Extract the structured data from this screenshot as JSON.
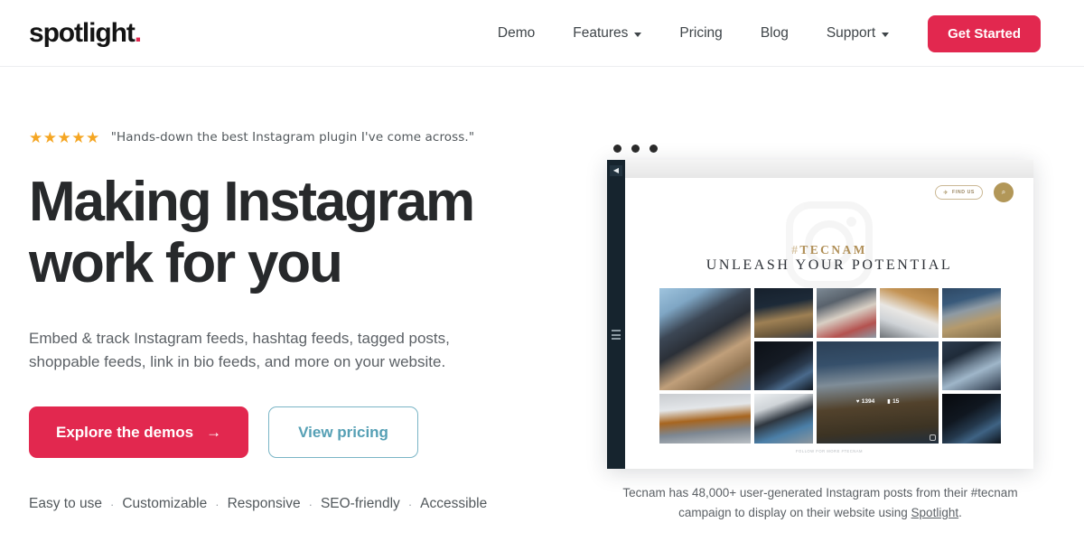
{
  "brand": {
    "name": "spotlight",
    "dot": ".",
    "accent": "#e2284f"
  },
  "nav": {
    "items": [
      {
        "label": "Demo",
        "caret": false
      },
      {
        "label": "Features",
        "caret": true
      },
      {
        "label": "Pricing",
        "caret": false
      },
      {
        "label": "Blog",
        "caret": false
      },
      {
        "label": "Support",
        "caret": true
      }
    ],
    "cta": "Get Started"
  },
  "hero": {
    "stars": "★★★★★",
    "rating_quote": "\"Hands-down the best Instagram plugin I've come across.\"",
    "headline_line1": "Making Instagram",
    "headline_line2": "work for you",
    "subhead_line1": "Embed & track Instagram feeds, hashtag feeds, tagged posts,",
    "subhead_line2": "shoppable feeds, link in bio feeds, and more on your website.",
    "primary_button": "Explore the demos",
    "primary_arrow": "→",
    "secondary_button": "View pricing",
    "features": [
      "Easy to use",
      "Customizable",
      "Responsive",
      "SEO-friendly",
      "Accessible"
    ],
    "feature_separator": "·"
  },
  "mockup": {
    "window_dots": 3,
    "rail_back_icon": "◀",
    "find_us_label": "FIND US",
    "find_us_icon": "✈",
    "search_icon": "⌕",
    "hash_mark": "#",
    "hashtag": "TECNAM",
    "slogan": "UNLEASH YOUR POTENTIAL",
    "post_likes": "1394",
    "post_comments": "15",
    "like_icon": "♥",
    "comment_icon": "▮",
    "mini_caption": "FOLLOW FOR MORE #TECNAM",
    "caption_line1": "Tecnam has 48,000+ user-generated Instagram posts from their",
    "caption_line2_pre": "#tecnam campaign to display on their website using ",
    "caption_link": "Spotlight",
    "caption_line2_post": ".",
    "tiles": [
      {
        "name": "pilot-cockpit-selfie",
        "css": "linear-gradient(150deg,#9fc4de 0%,#7fa6c4 18%,#3c4755 34%,#2b3038 48%,#c09f7a 66%,#8d7150 82%,#6f8096 100%)"
      },
      {
        "name": "coastline-aerial",
        "css": "linear-gradient(170deg,#16202c 0%,#1d2a38 34%,#9e8054 60%,#6e5a3c 82%,#3a3f49 100%)"
      },
      {
        "name": "pilot-sunglasses",
        "css": "linear-gradient(160deg,#7d8a95 0%,#59626c 28%,#d8cfc4 52%,#b4524f 78%,#8e9aa5 100%)"
      },
      {
        "name": "hangar-aircraft",
        "css": "linear-gradient(200deg,#a87a3f 0%,#c49455 26%,#e9e7e4 52%,#cfd3d7 72%,#6e7378 100%)"
      },
      {
        "name": "seaplane-over-coast-a",
        "css": "linear-gradient(165deg,#2e4864 0%,#395a7b 26%,#8e9aa4 44%,#b59a6c 66%,#7e6a48 100%)"
      },
      {
        "name": "night-cockpit-panel",
        "css": "linear-gradient(150deg,#0c1016 0%,#151b24 42%,#2a3a4e 62%,#4a6a8c 76%,#111820 100%)"
      },
      {
        "name": "seaplane-over-island",
        "css": "linear-gradient(175deg,#2b3f55 0%,#36506b 22%,#7f8d98 40%,#52422c 62%,#3c3323 84%,#22303f 100%)"
      },
      {
        "name": "cockpit-avionics",
        "css": "linear-gradient(155deg,#2c3b4d 0%,#1f2b39 28%,#6f8294 48%,#9fb6c9 62%,#2a3647 100%)"
      },
      {
        "name": "parked-light-aircraft",
        "css": "linear-gradient(175deg,#c9ccd0 0%,#e3e6e9 30%,#a7651f 52%,#7d8792 74%,#b9bfc4 100%)"
      },
      {
        "name": "desert-dunes-aerial",
        "css": "linear-gradient(165deg,#d8a95f 0%,#b78541 34%,#7a5b2e 58%,#3b4756 84%,#222a33 100%)"
      },
      {
        "name": "two-pilots-cabin",
        "css": "linear-gradient(160deg,#eceff1 0%,#cfd4d8 26%,#2f3740 48%,#4b7fa8 72%,#8d969d 100%)"
      },
      {
        "name": "night-flight-interior",
        "css": "linear-gradient(150deg,#07090d 0%,#101720 40%,#24384c 60%,#3f6384 74%,#0b1118 100%)"
      }
    ]
  }
}
